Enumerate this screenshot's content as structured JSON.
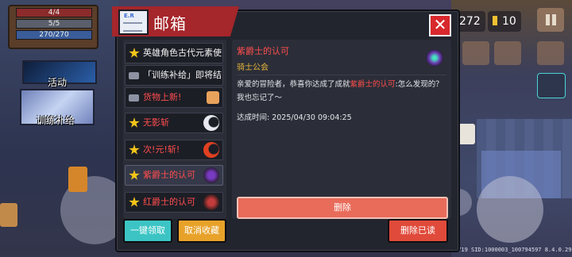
{
  "hud": {
    "hp": "4/4",
    "armor": "5/5",
    "energy": "270/270"
  },
  "side_labels": {
    "activity": "活动",
    "training": "训练补给"
  },
  "top_stats": {
    "gems": "272",
    "coins": "10"
  },
  "mail": {
    "title": "邮箱",
    "close_label": "✕",
    "items": [
      {
        "label": "英雄角色古代元素使",
        "starred": true
      },
      {
        "label": "「训练补给」即将结",
        "starred": false
      },
      {
        "label": "货物上新!",
        "starred": false
      },
      {
        "label": "无影斩",
        "starred": true
      },
      {
        "label": "次!元!斩!",
        "starred": true
      },
      {
        "label": "紫爵士的认可",
        "starred": true
      },
      {
        "label": "红爵士的认可",
        "starred": true
      }
    ],
    "detail": {
      "title": "紫爵士的认可",
      "sender": "骑士公会",
      "body_before": "亲爱的冒险者，恭喜你达成了成就",
      "body_highlight": "紫爵士的认可",
      "body_after": ":怎么发现的？我也忘记了～",
      "time": "达成时间:  2025/04/30 09:04:25",
      "delete_label": "删除"
    },
    "claim_all_label": "一键领取",
    "unfavorite_label": "取消收藏",
    "delete_read_label": "删除已读"
  },
  "version_text": "UID:139874719 SID:1000003_100794597 8.4.0.29"
}
